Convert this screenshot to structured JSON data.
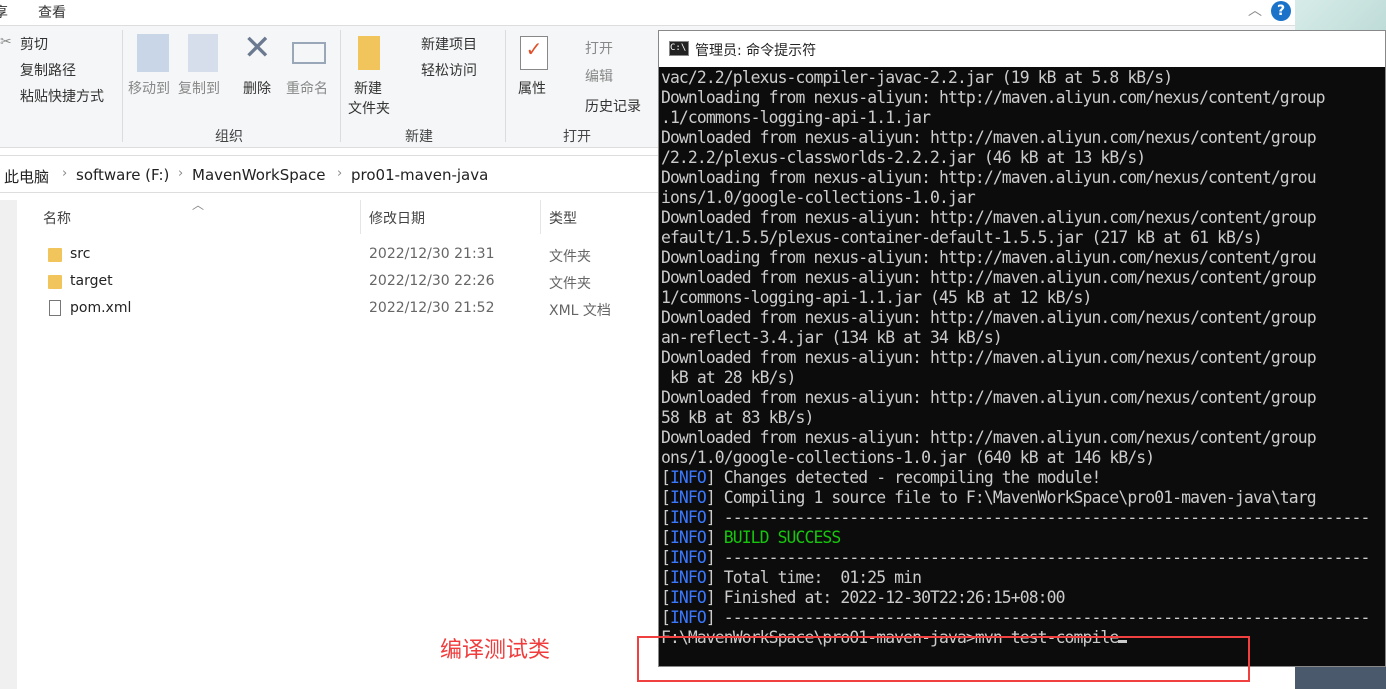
{
  "menubar": {
    "partial_tab": "享",
    "view_tab": "查看"
  },
  "ribbon": {
    "clipboard": {
      "cut": "剪切",
      "copy_path": "复制路径",
      "paste_shortcut": "粘贴快捷方式"
    },
    "organize": {
      "move_to": "移动到",
      "copy_to": "复制到",
      "delete": "删除",
      "rename": "重命名",
      "label": "组织"
    },
    "new": {
      "new_folder_1": "新建",
      "new_folder_2": "文件夹",
      "new_item": "新建项目",
      "easy_access": "轻松访问",
      "label": "新建"
    },
    "open": {
      "properties": "属性",
      "open": "打开",
      "edit": "编辑",
      "history": "历史记录",
      "label": "打开"
    }
  },
  "breadcrumb": [
    "此电脑",
    "software (F:)",
    "MavenWorkSpace",
    "pro01-maven-java"
  ],
  "columns": {
    "name": "名称",
    "date": "修改日期",
    "type": "类型"
  },
  "files": [
    {
      "name": "src",
      "date": "2022/12/30 21:31",
      "type": "文件夹",
      "icon": "folder"
    },
    {
      "name": "target",
      "date": "2022/12/30 22:26",
      "type": "文件夹",
      "icon": "folder"
    },
    {
      "name": "pom.xml",
      "date": "2022/12/30 21:52",
      "type": "XML 文档",
      "icon": "file"
    }
  ],
  "cmd": {
    "title": "管理员: 命令提示符",
    "lines": [
      "vac/2.2/plexus-compiler-javac-2.2.jar (19 kB at 5.8 kB/s)",
      "Downloading from nexus-aliyun: http://maven.aliyun.com/nexus/content/group",
      ".1/commons-logging-api-1.1.jar",
      "Downloaded from nexus-aliyun: http://maven.aliyun.com/nexus/content/group",
      "/2.2.2/plexus-classworlds-2.2.2.jar (46 kB at 13 kB/s)",
      "Downloading from nexus-aliyun: http://maven.aliyun.com/nexus/content/grou",
      "ions/1.0/google-collections-1.0.jar",
      "Downloaded from nexus-aliyun: http://maven.aliyun.com/nexus/content/group",
      "efault/1.5.5/plexus-container-default-1.5.5.jar (217 kB at 61 kB/s)",
      "Downloading from nexus-aliyun: http://maven.aliyun.com/nexus/content/grou",
      "Downloaded from nexus-aliyun: http://maven.aliyun.com/nexus/content/group",
      "1/commons-logging-api-1.1.jar (45 kB at 12 kB/s)",
      "Downloaded from nexus-aliyun: http://maven.aliyun.com/nexus/content/group",
      "an-reflect-3.4.jar (134 kB at 34 kB/s)",
      "Downloaded from nexus-aliyun: http://maven.aliyun.com/nexus/content/group",
      " kB at 28 kB/s)",
      "Downloaded from nexus-aliyun: http://maven.aliyun.com/nexus/content/group",
      "58 kB at 83 kB/s)",
      "Downloaded from nexus-aliyun: http://maven.aliyun.com/nexus/content/group",
      "ons/1.0/google-collections-1.0.jar (640 kB at 146 kB/s)"
    ],
    "info_tag": "INFO",
    "info_lines": [
      "Changes detected - recompiling the module!",
      "Compiling 1 source file to F:\\MavenWorkSpace\\pro01-maven-java\\targ",
      "------------------------------------------------------------------------",
      "BUILD SUCCESS",
      "------------------------------------------------------------------------",
      "Total time:  01:25 min",
      "Finished at: 2022-12-30T22:26:15+08:00",
      "------------------------------------------------------------------------"
    ],
    "prompt": "F:\\MavenWorkSpace\\pro01-maven-java>mvn test-compile"
  },
  "annotation": "编译测试类",
  "colors": {
    "info": "#3b78ff",
    "success": "#16c60c",
    "annotation": "#f03c3c"
  }
}
